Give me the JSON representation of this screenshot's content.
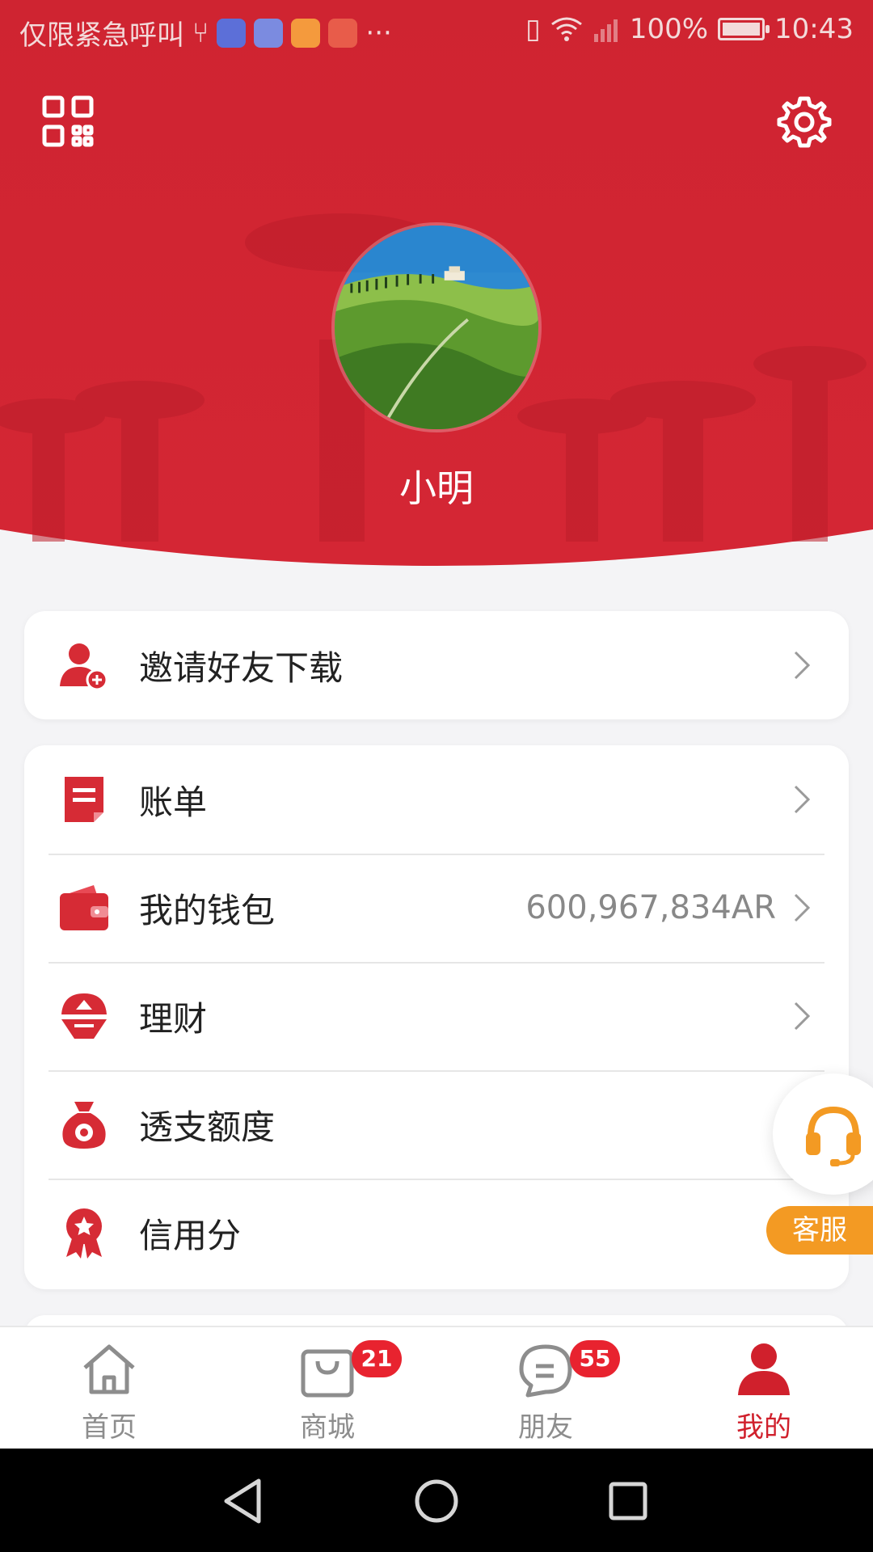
{
  "status_bar": {
    "carrier_text": "仅限紧急呼叫",
    "more": "···",
    "battery": "100%",
    "time": "10:43"
  },
  "header": {
    "username": "小明",
    "qr_icon": "qr-code-icon",
    "settings_icon": "gear-icon"
  },
  "invite": {
    "label": "邀请好友下载",
    "icon": "add-user-icon"
  },
  "menu": {
    "items": [
      {
        "label": "账单",
        "value": "",
        "icon": "bill-icon",
        "chevron": true
      },
      {
        "label": "我的钱包",
        "value": "600,967,834AR",
        "icon": "wallet-icon",
        "chevron": true
      },
      {
        "label": "理财",
        "value": "",
        "icon": "finance-icon",
        "chevron": true
      },
      {
        "label": "透支额度",
        "value": "",
        "icon": "money-bag-icon",
        "chevron": false
      },
      {
        "label": "信用分",
        "value": "",
        "icon": "award-ribbon-icon",
        "chevron": false
      }
    ]
  },
  "service": {
    "label": "客服",
    "icon": "headset-icon"
  },
  "tabbar": {
    "tabs": [
      {
        "label": "首页",
        "icon": "home-icon",
        "badge": "",
        "active": false
      },
      {
        "label": "商城",
        "icon": "shopping-bag-icon",
        "badge": "21",
        "active": false
      },
      {
        "label": "朋友",
        "icon": "chat-bubble-icon",
        "badge": "55",
        "active": false
      },
      {
        "label": "我的",
        "icon": "person-icon",
        "badge": "",
        "active": true
      }
    ]
  },
  "colors": {
    "brand_red": "#cf2431",
    "service_orange": "#f39a23",
    "badge_red": "#e8232f",
    "inactive_tab": "#8d8d8d"
  }
}
